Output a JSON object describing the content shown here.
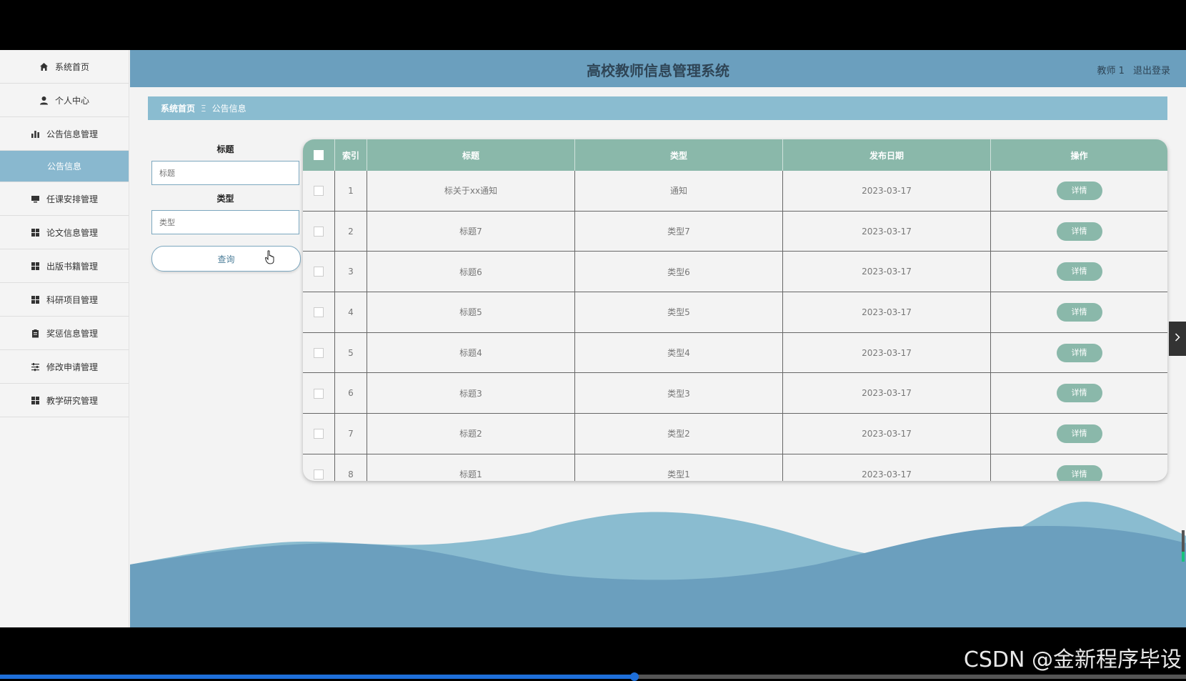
{
  "app": {
    "title": "高校教师信息管理系统"
  },
  "user": {
    "name": "教师 1",
    "logout_label": "退出登录"
  },
  "sidebar": {
    "items": [
      {
        "label": "系统首页",
        "icon": "home-icon"
      },
      {
        "label": "个人中心",
        "icon": "user-icon"
      },
      {
        "label": "公告信息管理",
        "icon": "bar-chart-icon"
      },
      {
        "label": "公告信息",
        "icon": ""
      },
      {
        "label": "任课安排管理",
        "icon": "monitor-icon"
      },
      {
        "label": "论文信息管理",
        "icon": "grid-icon"
      },
      {
        "label": "出版书籍管理",
        "icon": "grid-icon"
      },
      {
        "label": "科研项目管理",
        "icon": "grid-icon"
      },
      {
        "label": "奖惩信息管理",
        "icon": "clipboard-icon"
      },
      {
        "label": "修改申请管理",
        "icon": "sliders-icon"
      },
      {
        "label": "教学研究管理",
        "icon": "grid-icon"
      }
    ]
  },
  "breadcrumb": {
    "home": "系统首页",
    "separator": "Ξ",
    "current": "公告信息"
  },
  "search": {
    "title_label": "标题",
    "title_placeholder": "标题",
    "type_label": "类型",
    "type_placeholder": "类型",
    "query_button": "查询"
  },
  "table": {
    "headers": [
      "索引",
      "标题",
      "类型",
      "发布日期",
      "操作"
    ],
    "rows": [
      {
        "index": "1",
        "title": "标关于xx通知",
        "type": "通知",
        "date": "2023-03-17",
        "action": "详情"
      },
      {
        "index": "2",
        "title": "标题7",
        "type": "类型7",
        "date": "2023-03-17",
        "action": "详情"
      },
      {
        "index": "3",
        "title": "标题6",
        "type": "类型6",
        "date": "2023-03-17",
        "action": "详情"
      },
      {
        "index": "4",
        "title": "标题5",
        "type": "类型5",
        "date": "2023-03-17",
        "action": "详情"
      },
      {
        "index": "5",
        "title": "标题4",
        "type": "类型4",
        "date": "2023-03-17",
        "action": "详情"
      },
      {
        "index": "6",
        "title": "标题3",
        "type": "类型3",
        "date": "2023-03-17",
        "action": "详情"
      },
      {
        "index": "7",
        "title": "标题2",
        "type": "类型2",
        "date": "2023-03-17",
        "action": "详情"
      },
      {
        "index": "8",
        "title": "标题1",
        "type": "类型1",
        "date": "2023-03-17",
        "action": "详情"
      }
    ]
  },
  "video": {
    "progress": 0.535
  },
  "watermark": "CSDN @金新程序毕设",
  "colors": {
    "header": "#6b9fbe",
    "accent": "#8abcd0",
    "table_header": "#8ab8aa",
    "wave_dark": "#6b9fbe",
    "wave_light": "#8abcd0"
  }
}
